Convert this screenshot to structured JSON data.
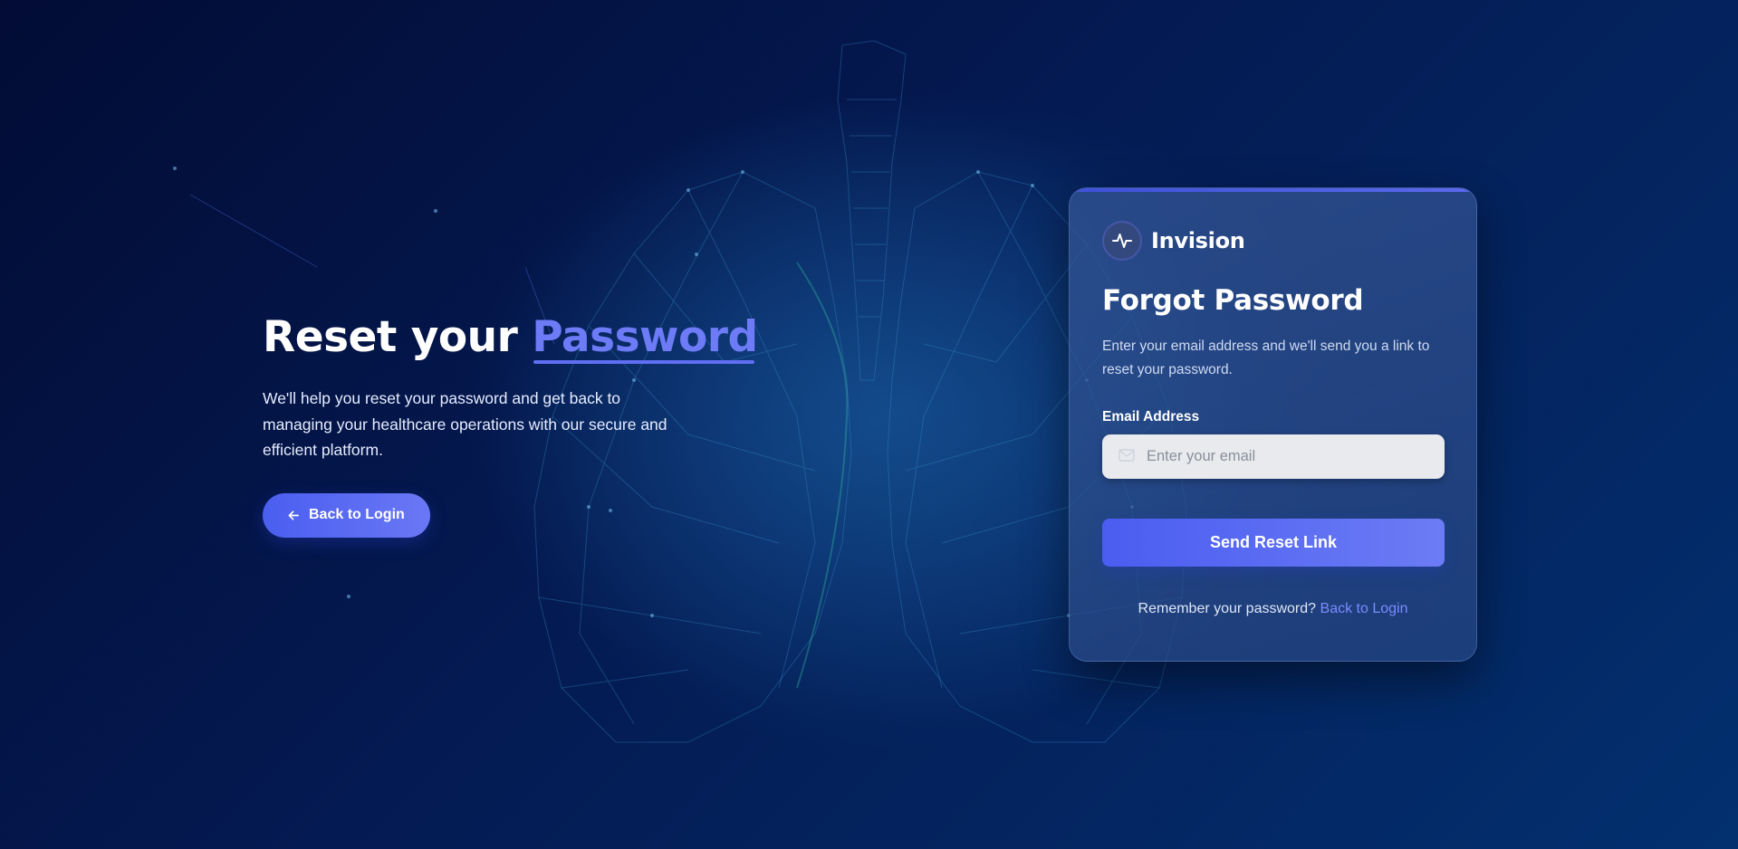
{
  "hero": {
    "title_prefix": "Reset your",
    "title_accent": "Password",
    "subtitle": "We'll help you reset your password and get back to managing your healthcare operations with our secure and efficient platform.",
    "back_button_label": "Back to Login",
    "back_button_icon": "arrow-left-icon"
  },
  "card": {
    "brand_name": "Invision",
    "brand_icon": "pulse-icon",
    "title": "Forgot Password",
    "description": "Enter your email address and we'll send you a link to reset your password.",
    "email_label": "Email Address",
    "email_placeholder": "Enter your email",
    "email_value": "",
    "email_icon": "mail-icon",
    "submit_label": "Send Reset Link",
    "remember_text": "Remember your password?",
    "remember_link": "Back to Login"
  },
  "colors": {
    "accent": "#5f6ef2",
    "background_dark": "#020c35",
    "background_light": "#03306f",
    "link": "#7a8bff"
  }
}
